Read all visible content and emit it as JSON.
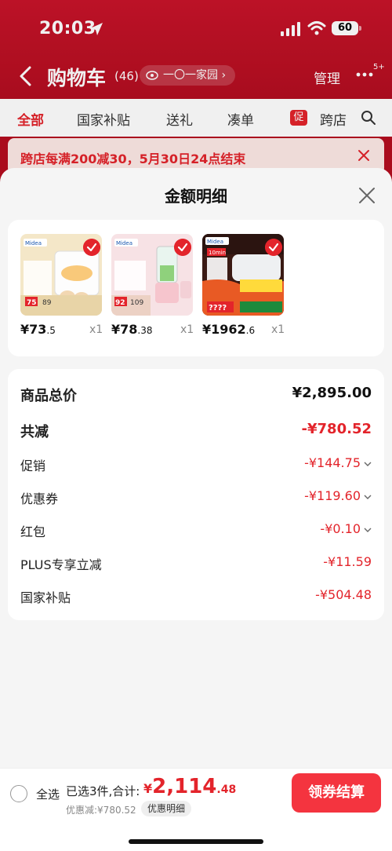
{
  "status_bar": {
    "time": "20:03",
    "battery": "60"
  },
  "nav": {
    "title": "购物车",
    "count": "(46)",
    "family_pill": "一〇一家园",
    "manage": "管理",
    "more_badge": "5+"
  },
  "tabs": [
    {
      "label": "全部",
      "active": true
    },
    {
      "label": "国家补贴"
    },
    {
      "label": "送礼"
    },
    {
      "label": "凑单"
    },
    {
      "label": "跨店",
      "promo_badge": "促"
    }
  ],
  "banner": {
    "text": "跨店每满200减30，5月30日24点结束"
  },
  "sheet": {
    "title": "金额明细",
    "products": [
      {
        "brand": "Midea",
        "price_main": "¥73",
        "price_dec": ".5",
        "qty": "x1",
        "image": "egg-steamer",
        "tags": [
          "75",
          "89"
        ]
      },
      {
        "brand": "Midea",
        "price_main": "¥78",
        "price_dec": ".38",
        "qty": "x1",
        "image": "blender",
        "tags": [
          "92",
          "109"
        ]
      },
      {
        "brand": "Midea",
        "price_main": "¥1962",
        "price_dec": ".6",
        "qty": "x1",
        "image": "water-heater",
        "tags": [
          "10min",
          "????"
        ]
      }
    ],
    "summary": {
      "total": {
        "label": "商品总价",
        "value": "¥2,895.00"
      },
      "reduction": {
        "label": "共减",
        "value": "-¥780.52"
      },
      "rows": [
        {
          "label": "促销",
          "value": "-¥144.75",
          "expandable": true
        },
        {
          "label": "优惠券",
          "value": "-¥119.60",
          "expandable": true
        },
        {
          "label": "红包",
          "value": "-¥0.10",
          "expandable": true
        },
        {
          "label": "PLUS专享立减",
          "value": "-¥11.59",
          "expandable": false
        },
        {
          "label": "国家补贴",
          "value": "-¥504.48",
          "expandable": false
        }
      ]
    }
  },
  "bottom_bar": {
    "select_all": "全选",
    "selected_label": "已选3件,合计:",
    "total_currency": "¥",
    "total_main": "2,114",
    "total_dec": ".48",
    "discount_label": "优惠减:¥780.52",
    "detail_button": "优惠明细",
    "checkout_button": "领券结算"
  },
  "colors": {
    "accent": "#e3242b",
    "header_bg": "#b50d1f",
    "checkout": "#f4343f"
  }
}
